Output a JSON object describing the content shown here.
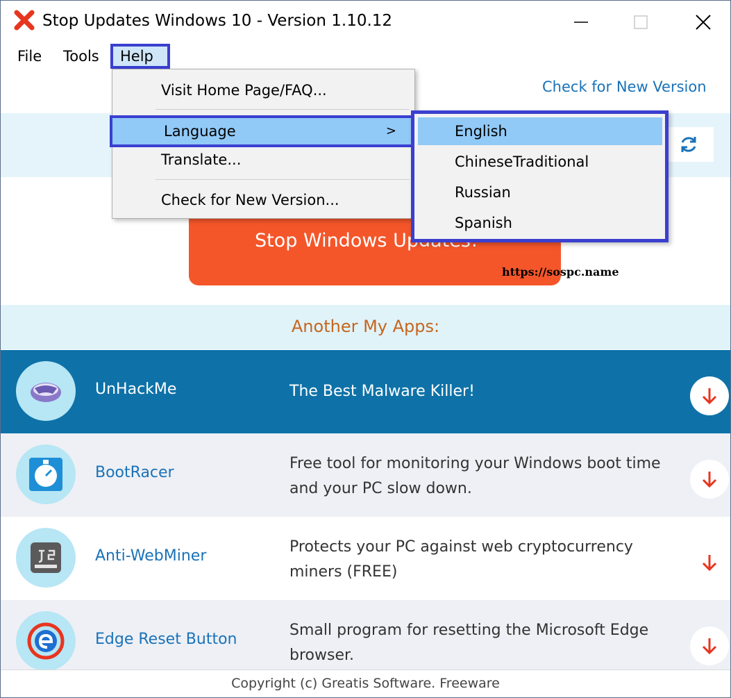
{
  "window": {
    "title": "Stop Updates Windows 10 - Version 1.10.12",
    "icon": "red-x-icon"
  },
  "menubar": {
    "file": "File",
    "tools": "Tools",
    "help": "Help"
  },
  "help_menu": {
    "items": [
      {
        "label": "Visit Home Page/FAQ..."
      },
      {
        "label": "Language"
      },
      {
        "label": "Translate..."
      },
      {
        "label": "Check for New Version..."
      }
    ],
    "submenu_arrow": ">"
  },
  "language_menu": {
    "items": [
      "English",
      "ChineseTraditional",
      "Russian",
      "Spanish"
    ],
    "selected": "English"
  },
  "main": {
    "check_link": "Check for New Version",
    "stop_button": "Stop Windows Updates!",
    "url": "https://sospc.name",
    "apps_title": "Another My Apps:"
  },
  "apps": [
    {
      "name": "UnHackMe",
      "desc": "The Best Malware Killer!",
      "icon": "unhackme-icon"
    },
    {
      "name": "BootRacer",
      "desc": "Free tool for monitoring your Windows boot time and your PC slow down.",
      "icon": "stopwatch-icon"
    },
    {
      "name": "Anti-WebMiner",
      "desc": "Protects your PC against web cryptocurrency miners  (FREE)",
      "icon": "js-miner-icon"
    },
    {
      "name": "Edge Reset Button",
      "desc": "Small program for resetting the Microsoft Edge browser.",
      "icon": "edge-reset-icon"
    }
  ],
  "footer": "Copyright  (c) Greatis Software.  Freeware",
  "colors": {
    "accent_blue": "#1a72b8",
    "stop_orange": "#f4562a",
    "highlight_border": "#3a3fd0",
    "selected_row": "#0e72a8"
  }
}
